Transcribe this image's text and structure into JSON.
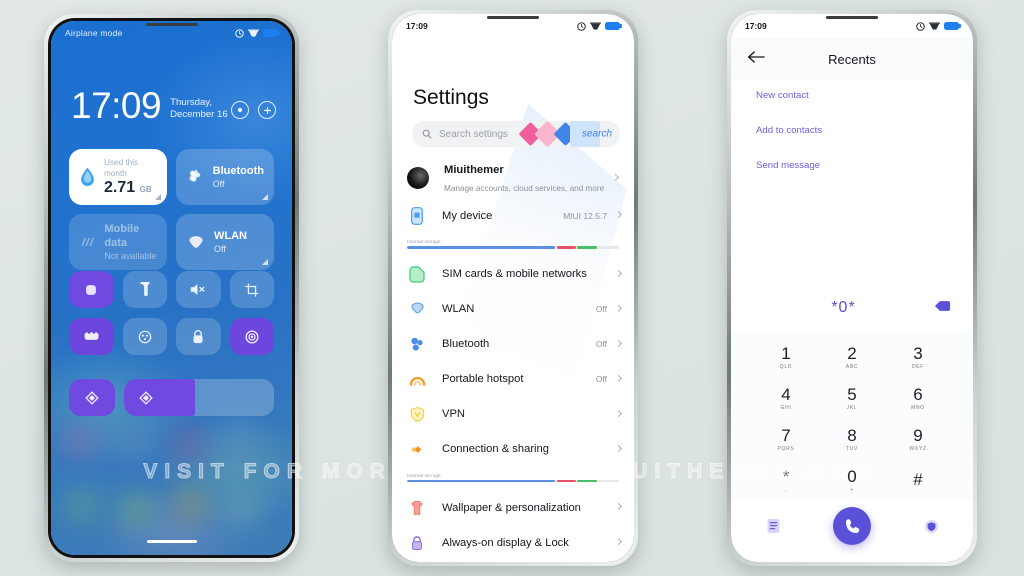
{
  "background_color": "#dfe6e4",
  "watermark": "VISIT FOR MORE THEMES - MIUITHEMER.COM",
  "phone1": {
    "name": "lockscreen-control-center",
    "status_bar": {
      "label": "Airplane mode",
      "icons": [
        "alarm-icon",
        "vpn-icon",
        "battery-icon"
      ]
    },
    "clock": "17:09",
    "date": "Thursday, December 16",
    "lock_actions": [
      "camera-shortcut-icon",
      "add-shortcut-icon"
    ],
    "tiles": [
      {
        "type": "data-usage",
        "icon": "water-drop-icon",
        "top": "Used this month",
        "value": "2.71",
        "unit": "GB",
        "style": "white"
      },
      {
        "type": "toggle",
        "icon": "bluetooth-icon",
        "title": "Bluetooth",
        "sub": "Off",
        "style": "translucent"
      },
      {
        "type": "toggle",
        "icon": "mobile-data-icon",
        "title": "Mobile data",
        "sub": "Not available",
        "style": "dim"
      },
      {
        "type": "toggle",
        "icon": "wlan-icon",
        "title": "WLAN",
        "sub": "Off",
        "style": "translucent"
      }
    ],
    "quick_settings": [
      {
        "icon": "screen-lock-icon",
        "active": true
      },
      {
        "icon": "flashlight-icon",
        "active": false
      },
      {
        "icon": "mute-icon",
        "active": false
      },
      {
        "icon": "screenshot-icon",
        "active": false
      },
      {
        "icon": "do-not-disturb-icon",
        "active": true
      },
      {
        "icon": "dark-mode-icon",
        "active": false
      },
      {
        "icon": "lock-icon",
        "active": false
      },
      {
        "icon": "location-icon",
        "active": true
      }
    ],
    "quick_settings_row3": [
      {
        "icon": "brightness-icon",
        "active": true
      },
      {
        "icon": "brightness-slider-icon",
        "active": true,
        "fill_percent": 47
      }
    ]
  },
  "phone2": {
    "name": "settings-screen",
    "status_bar": {
      "time": "17:09",
      "icons": [
        "alarm-icon",
        "vpn-icon",
        "battery-icon"
      ]
    },
    "title": "Settings",
    "search": {
      "placeholder": "Search settings",
      "icon": "search-icon",
      "decor_word": "search"
    },
    "storage_label": "Internal storage",
    "storage_segments": [
      {
        "color": "#5b8fe0",
        "width": 70
      },
      {
        "color": "#e8516a",
        "width": 9
      },
      {
        "color": "#48c06a",
        "width": 9
      }
    ],
    "list": [
      {
        "type": "account",
        "icon": "avatar",
        "title": "Miuithemer",
        "subtitle": "Manage accounts, cloud services, and more",
        "value": "",
        "arrow": true
      },
      {
        "type": "item",
        "icon": "my-device-icon",
        "icon_color": "#4a9ef0",
        "label": "My device",
        "value": "MIUI 12.5.7",
        "arrow": true
      },
      {
        "type": "separator"
      },
      {
        "type": "item",
        "icon": "sim-card-icon",
        "icon_color": "#4ad07e",
        "label": "SIM cards & mobile networks",
        "value": "",
        "arrow": true
      },
      {
        "type": "item",
        "icon": "wlan-icon",
        "icon_color": "#6fa9e8",
        "label": "WLAN",
        "value": "Off",
        "arrow": true
      },
      {
        "type": "item",
        "icon": "bluetooth-icon",
        "icon_color": "#4a90ea",
        "label": "Bluetooth",
        "value": "Off",
        "arrow": true
      },
      {
        "type": "item",
        "icon": "hotspot-icon",
        "icon_color": "#f0a030",
        "label": "Portable hotspot",
        "value": "Off",
        "arrow": true
      },
      {
        "type": "item",
        "icon": "vpn-icon",
        "icon_color": "#f3d34a",
        "label": "VPN",
        "value": "",
        "arrow": true
      },
      {
        "type": "item",
        "icon": "connection-sharing-icon",
        "icon_color": "#f0901e",
        "label": "Connection & sharing",
        "value": "",
        "arrow": true
      },
      {
        "type": "separator"
      },
      {
        "type": "item",
        "icon": "wallpaper-icon",
        "icon_color": "#f4746e",
        "label": "Wallpaper & personalization",
        "value": "",
        "arrow": true
      },
      {
        "type": "item",
        "icon": "always-on-display-icon",
        "icon_color": "#8a6fe0",
        "label": "Always-on display & Lock",
        "value": "",
        "arrow": true
      }
    ]
  },
  "phone3": {
    "name": "dialer-recents-screen",
    "status_bar": {
      "time": "17:09",
      "icons": [
        "alarm-icon",
        "vpn-icon",
        "battery-icon"
      ]
    },
    "header": {
      "back_icon": "back-arrow-icon",
      "title": "Recents"
    },
    "links": [
      "New contact",
      "Add to contacts",
      "Send message"
    ],
    "dialed_number": "*0*",
    "backspace_icon": "backspace-icon",
    "keypad": [
      {
        "digit": "1",
        "letters": "QLD"
      },
      {
        "digit": "2",
        "letters": "ABC"
      },
      {
        "digit": "3",
        "letters": "DEF"
      },
      {
        "digit": "4",
        "letters": "GHI"
      },
      {
        "digit": "5",
        "letters": "JKL"
      },
      {
        "digit": "6",
        "letters": "MNO"
      },
      {
        "digit": "7",
        "letters": "PQRS"
      },
      {
        "digit": "8",
        "letters": "TUV"
      },
      {
        "digit": "9",
        "letters": "WXYZ"
      },
      {
        "digit": "*",
        "letters": ","
      },
      {
        "digit": "0",
        "letters": "+"
      },
      {
        "digit": "#",
        "letters": ""
      }
    ],
    "bottom_bar": {
      "left_icon": "keypad-list-icon",
      "call_icon": "call-icon",
      "right_icon": "contacts-icon"
    },
    "accent_color": "#5b51d8"
  }
}
